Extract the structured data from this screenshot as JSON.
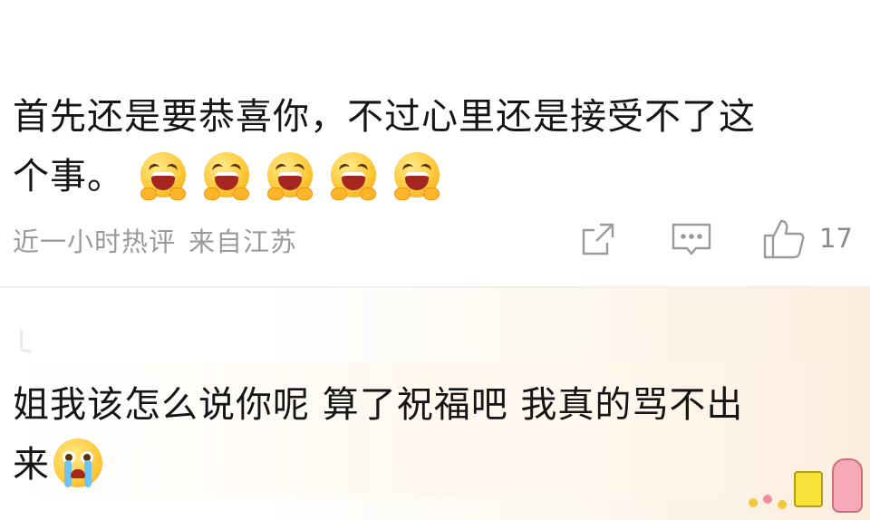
{
  "comments": [
    {
      "text_line1": "首先还是要恭喜你，不过心里还是接受不了这",
      "text_line2": "个事。",
      "emojis": [
        "crying-loud-icon",
        "crying-loud-icon",
        "crying-loud-icon",
        "crying-loud-icon",
        "crying-loud-icon"
      ],
      "time": "近一小时热评",
      "location": "来自江苏",
      "actions": {
        "share_icon": "share-icon",
        "comment_icon": "comment-icon",
        "like_icon": "thumbs-up-icon"
      },
      "like_count": "17"
    },
    {
      "text_line1": "姐我该怎么说你呢 算了祝福吧 我真的骂不出",
      "text_line2": "来",
      "emoji": "crying-tears-icon"
    }
  ],
  "colors": {
    "meta": "#9a9a9a",
    "text": "#151515",
    "emoji": "#ffc93a"
  },
  "watermark_sticker": "spongebob-patrick-sticker-icon"
}
